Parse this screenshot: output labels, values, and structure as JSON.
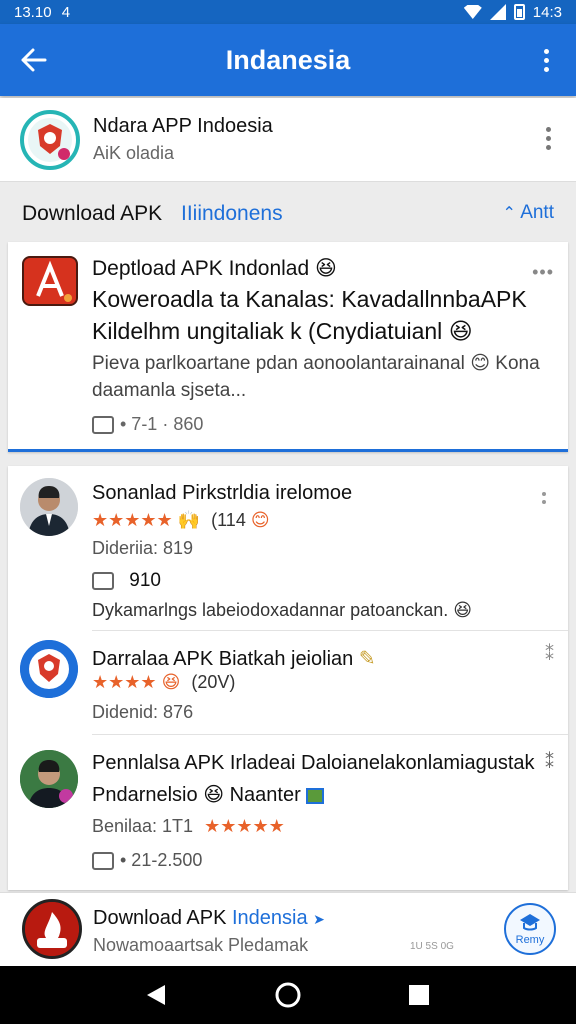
{
  "status_bar": {
    "time": "13.10",
    "extra": "4",
    "right_time": "14:3"
  },
  "app_bar": {
    "title": "Indanesia"
  },
  "channel": {
    "name": "Ndara APP Indoesia",
    "subtitle": "AiK oladia"
  },
  "section": {
    "title": "Download APK",
    "tag": "IIiindonens",
    "action": "Antt"
  },
  "featured": {
    "line1": "Deptload APK Indonlad",
    "line2": "Koweroadla ta Kanalas: KavadallnnbaAPK",
    "line3": "Kildelhm ungitaliak k (Cnydiatuianl",
    "desc1": "Pieva parlkoartane pdan aonoolantarainanal",
    "desc1_end": "Kona",
    "desc2": "daamanla sjseta...",
    "meta": "• 7-1 · 860"
  },
  "list": [
    {
      "title": "Sonanlad Pirkstrldia irelomoe",
      "stars": "★★★★★",
      "count": "(114",
      "line1": "Dideriia: 819",
      "chip_value": "910",
      "line2": "Dykamarlngs labeiodoxadannar patoanckan."
    },
    {
      "title": "Darralaa APK Biatkah jeiolian",
      "stars": "★★★★",
      "count": "(20V)",
      "line1": "Didenid: 876"
    },
    {
      "title": "Pennlalsa APK Irladeai Daloianelakonlamiagustak",
      "line2": "Pndarnelsio",
      "line2_end": "Naanter",
      "line3": "Benilaa: 1T1",
      "stars": "★★★★★",
      "meta": "• 21-2.500"
    }
  ],
  "bottom_bar": {
    "title": "Download APK",
    "title_blue": "Indensia",
    "subtitle": "Nowamoaartsak Pledamak",
    "small": "1U 5S 0G",
    "fab_label": "Remy"
  },
  "colors": {
    "primary": "#1e6fd9",
    "star": "#e8622a"
  }
}
